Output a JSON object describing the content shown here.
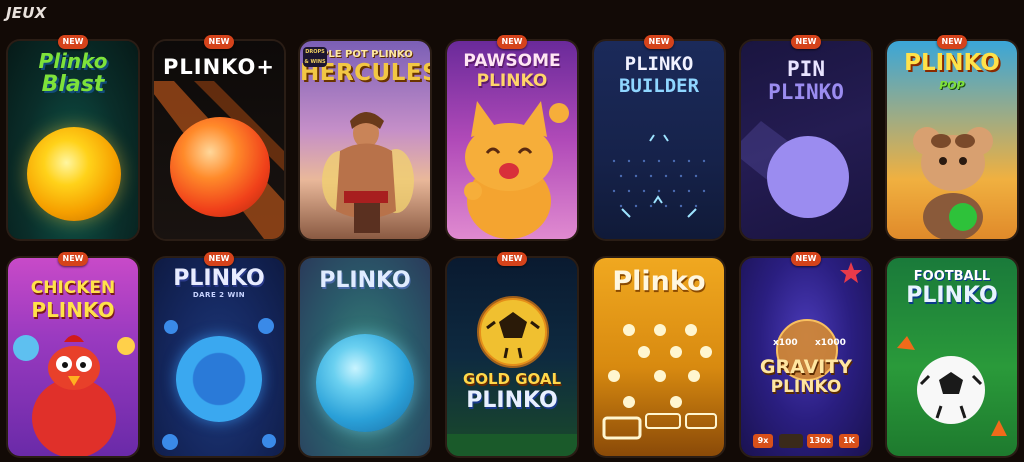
{
  "section": {
    "title": "JEUX"
  },
  "badge_label": "NEW",
  "row1": [
    {
      "title_lines": [
        "Plinko",
        "Blast"
      ],
      "new": true
    },
    {
      "title": "PLINKO+",
      "new": true
    },
    {
      "title_top": "IPLE POT PLINKO",
      "title": "HERCULES",
      "tag": "DROPS & WINS",
      "new": false
    },
    {
      "title_lines": [
        "PAWSOME",
        "PLINKO"
      ],
      "new": true
    },
    {
      "title_lines": [
        "PLINKO",
        "BUILDER"
      ],
      "new": true
    },
    {
      "title_lines": [
        "PIN",
        "PLINKO"
      ],
      "new": true
    },
    {
      "title": "PLINKO",
      "subtitle": "POP",
      "new": true
    }
  ],
  "row2": [
    {
      "title_lines": [
        "CHICKEN",
        "PLINKO"
      ],
      "new": true
    },
    {
      "title": "PLINKO",
      "subtitle": "DARE 2 WIN",
      "new": true
    },
    {
      "title": "PLINKO",
      "new": false
    },
    {
      "title_lines": [
        "GOLD GOAL",
        "PLINKO"
      ],
      "new": true
    },
    {
      "title": "Plinko",
      "new": false
    },
    {
      "title_lines": [
        "GRAVITY",
        "PLINKO"
      ],
      "multipliers": [
        "x100",
        "x1000"
      ],
      "chips": [
        "9x",
        "130x",
        "1K"
      ],
      "new": true
    },
    {
      "title_lines": [
        "FOOTBALL",
        "PLINKO"
      ],
      "new": false
    }
  ]
}
